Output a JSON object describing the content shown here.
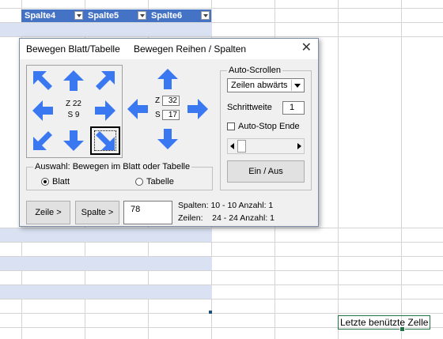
{
  "sheet": {
    "columns": [
      {
        "label": "Spalte4"
      },
      {
        "label": "Spalte5"
      },
      {
        "label": "Spalte6"
      }
    ],
    "active_cell_text": "Letzte benützte Zelle",
    "header_color": "#4472c4",
    "band_color": "#d9e1f2"
  },
  "dialog": {
    "tabs": [
      "Bewegen Blatt/Tabelle",
      "Bewegen Reihen / Spalten"
    ],
    "close_label": "✕",
    "sheet_arrows": {
      "center_line1": "Z 22",
      "center_line2": "S 9"
    },
    "row_arrows": {
      "z_label": "Z",
      "z_value": "32",
      "s_label": "S",
      "s_value": "17"
    },
    "auswahl": {
      "legend": "Auswahl: Bewegen im Blatt oder Tabelle",
      "option_blatt": "Blatt",
      "option_tabelle": "Tabelle",
      "selected": "Blatt"
    },
    "auto_scroll": {
      "legend": "Auto-Scrollen",
      "direction_value": "Zeilen abwärts",
      "step_label": "Schrittweite",
      "step_value": "1",
      "auto_stop_label": "Auto-Stop Ende",
      "auto_stop_checked": false,
      "toggle_label": "Ein / Aus"
    },
    "bottom": {
      "zeile_button": "Zeile >",
      "spalte_button": "Spalte >",
      "number_value": "78",
      "spalten_info": "Spalten: 10 - 10 Anzahl: 1",
      "zeilen_info": "Zeilen:    24 - 24 Anzahl: 1"
    },
    "accent_color": "#3a78f2"
  }
}
